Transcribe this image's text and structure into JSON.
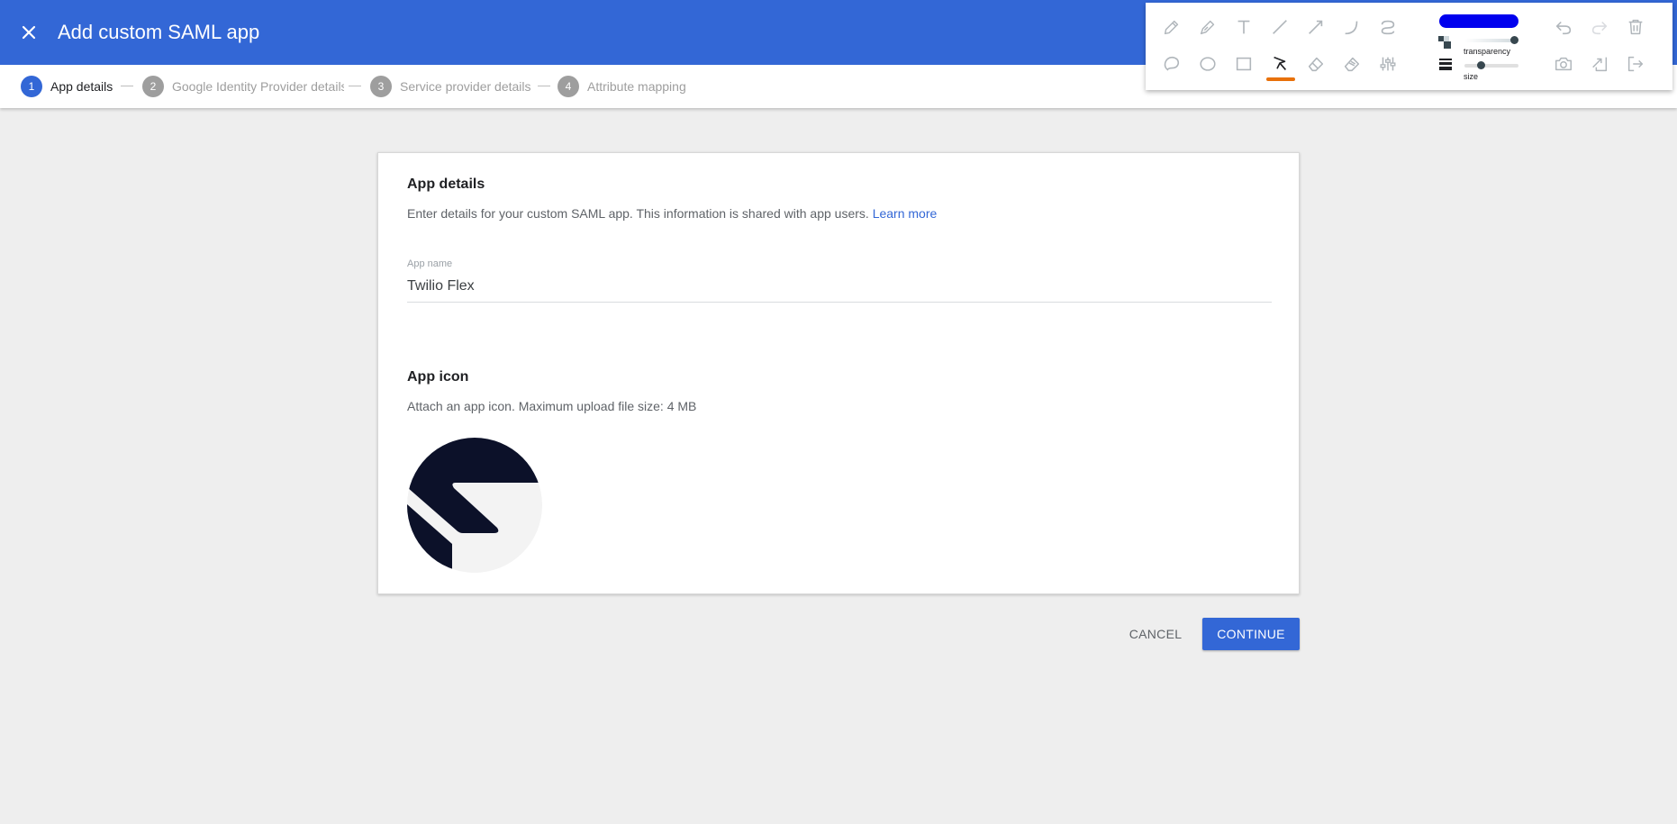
{
  "header": {
    "title": "Add custom SAML app",
    "close_icon": "close-icon"
  },
  "stepper": {
    "steps": [
      {
        "number": "1",
        "label": "App details",
        "active": true
      },
      {
        "number": "2",
        "label": "Google Identity Provider details",
        "active": false
      },
      {
        "number": "3",
        "label": "Service provider details",
        "active": false
      },
      {
        "number": "4",
        "label": "Attribute mapping",
        "active": false
      }
    ]
  },
  "card": {
    "app_details_title": "App details",
    "app_details_desc": "Enter details for your custom SAML app. This information is shared with app users.",
    "learn_more": "Learn more",
    "app_name_label": "App name",
    "app_name_value": "Twilio Flex",
    "app_icon_title": "App icon",
    "app_icon_desc": "Attach an app icon. Maximum upload file size: 4 MB"
  },
  "actions": {
    "cancel_label": "CANCEL",
    "continue_label": "CONTINUE"
  },
  "drawing_toolbar": {
    "tools_row1": [
      "pencil-icon",
      "pen-icon",
      "text-icon",
      "line-icon",
      "arrow-icon",
      "curve-icon",
      "squiggle-icon"
    ],
    "tools_row2": [
      "lasso-icon",
      "ellipse-icon",
      "rectangle-icon",
      "select-cursor-icon",
      "eraser-icon",
      "clear-marker-icon",
      "settings-sliders-icon"
    ],
    "selected_tool": "select-cursor-icon",
    "color": "#0000ee",
    "transparency_label": "transparency",
    "size_label": "size",
    "actions": [
      "undo-icon",
      "redo-icon",
      "trash-icon",
      "camera-icon",
      "share-icon",
      "exit-icon"
    ]
  },
  "colors": {
    "primary": "#3367d6",
    "active_tool_indicator": "#e8710a"
  }
}
